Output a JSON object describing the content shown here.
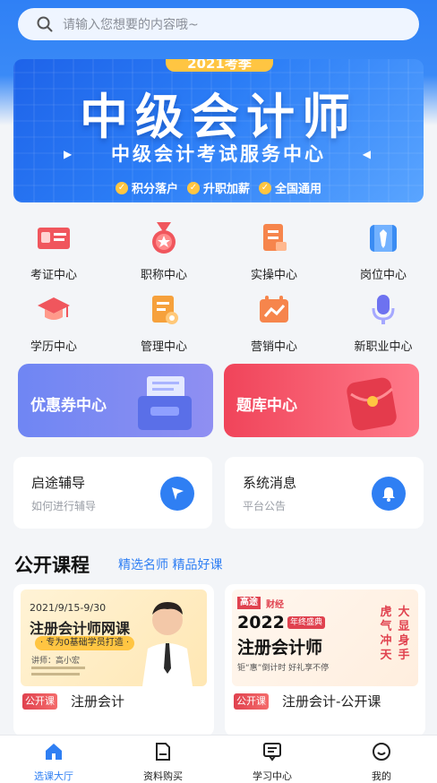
{
  "search": {
    "placeholder": "请输入您想要的内容哦~"
  },
  "banner": {
    "year": "2021考季",
    "title": "中级会计师",
    "subtitle": "中级会计考试服务中心",
    "tags": [
      "积分落户",
      "升职加薪",
      "全国通用"
    ]
  },
  "grid": [
    {
      "label": "考证中心",
      "icon": "certificate-icon"
    },
    {
      "label": "职称中心",
      "icon": "medal-icon"
    },
    {
      "label": "实操中心",
      "icon": "document-icon"
    },
    {
      "label": "岗位中心",
      "icon": "tie-icon"
    },
    {
      "label": "学历中心",
      "icon": "graduation-cap-icon"
    },
    {
      "label": "管理中心",
      "icon": "management-icon"
    },
    {
      "label": "营销中心",
      "icon": "marketing-icon"
    },
    {
      "label": "新职业中心",
      "icon": "microphone-icon"
    }
  ],
  "cards": [
    {
      "label": "优惠券中心"
    },
    {
      "label": "题库中心"
    }
  ],
  "messages": [
    {
      "title": "启途辅导",
      "sub": "如何进行辅导"
    },
    {
      "title": "系统消息",
      "sub": "平台公告"
    }
  ],
  "section": {
    "title": "公开课程",
    "subtitle": "精选名师 精品好课"
  },
  "courses": [
    {
      "tag": "公开课",
      "title": "注册会计",
      "thumb": {
        "date": "2021/9/15-9/30",
        "headline": "注册会计师网课",
        "ribbon": "· 专为0基础学员打造 ·",
        "teacher": "讲师：高小宏"
      }
    },
    {
      "tag": "公开课",
      "title": "注册会计-公开课",
      "thumb": {
        "brand": "高途",
        "brand2": "财经",
        "year": "2022",
        "badge": "年终盛典",
        "headline": "注册会计师",
        "slogan": "钜“惠”倒计时 好礼享不停",
        "side": [
          "虎",
          "大",
          "气",
          "显",
          "冲",
          "身",
          "天",
          "手"
        ]
      }
    }
  ],
  "tabs": [
    {
      "label": "选课大厅",
      "active": true
    },
    {
      "label": "资料购买"
    },
    {
      "label": "学习中心"
    },
    {
      "label": "我的"
    }
  ],
  "colors": {
    "primary": "#2f7ff3",
    "accent_red": "#e0424f"
  }
}
